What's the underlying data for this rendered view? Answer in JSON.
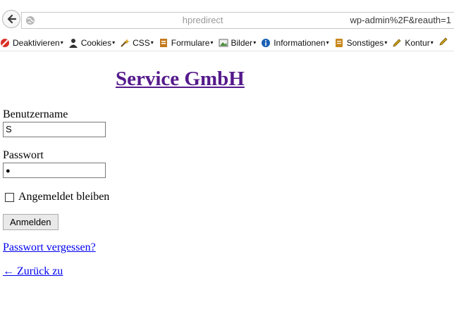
{
  "browser": {
    "url_visible_fragment": "wp-admin%2F&reauth=1",
    "url_left_fragment": "hpredirect"
  },
  "bookmarks": [
    {
      "label": "Deaktivieren",
      "icon": "disable-icon",
      "color": "#d93025"
    },
    {
      "label": "Cookies",
      "icon": "person-icon",
      "color": "#333333"
    },
    {
      "label": "CSS",
      "icon": "wand-icon",
      "color": "#d4a017"
    },
    {
      "label": "Formulare",
      "icon": "form-icon",
      "color": "#c47a1d"
    },
    {
      "label": "Bilder",
      "icon": "image-icon",
      "color": "#4a8f3a"
    },
    {
      "label": "Informationen",
      "icon": "info-icon",
      "color": "#1a5fb4"
    },
    {
      "label": "Sonstiges",
      "icon": "notes-icon",
      "color": "#c8881c"
    },
    {
      "label": "Kontur",
      "icon": "pencil-icon",
      "color": "#c8a017"
    }
  ],
  "page": {
    "site_title": "Service GmbH",
    "username_label": "Benutzername",
    "username_value": "S",
    "password_label": "Passwort",
    "password_value": "●",
    "remember_label": "Angemeldet bleiben",
    "submit_label": "Anmelden",
    "lost_password_link": "Passwort vergessen?",
    "back_link": "← Zurück zu"
  },
  "colors": {
    "visited_link": "#551a8b",
    "link": "#0000ee"
  }
}
